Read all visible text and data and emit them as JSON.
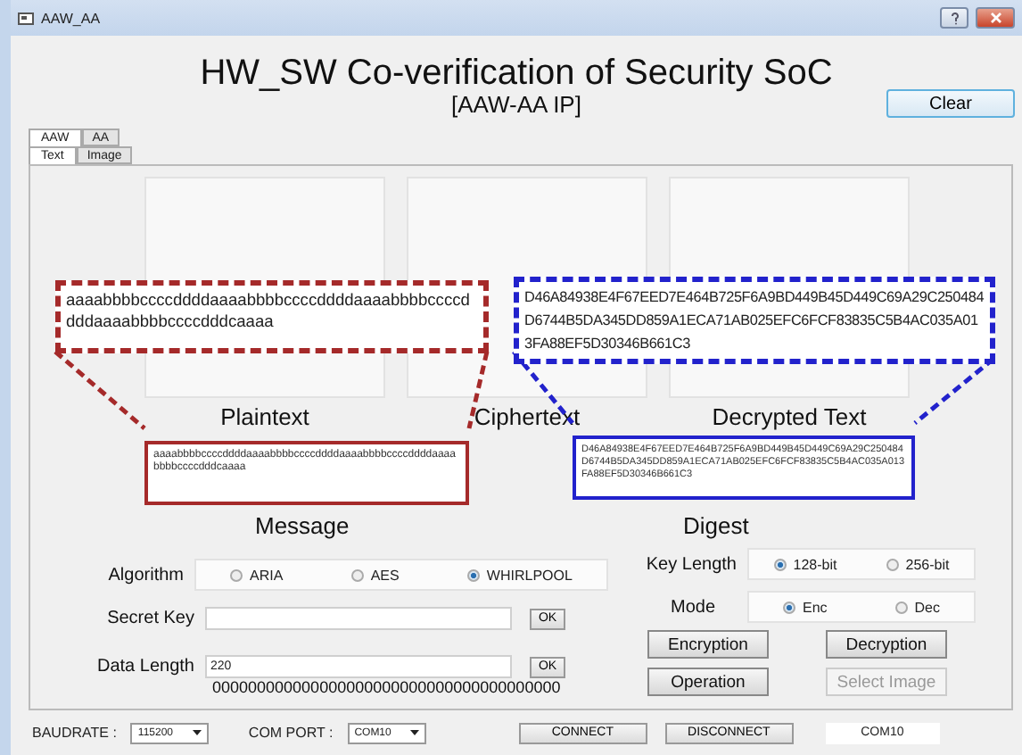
{
  "window": {
    "title": "AAW_AA"
  },
  "header": {
    "title": "HW_SW Co-verification of Security SoC",
    "subtitle": "[AAW-AA IP]",
    "clear_button": "Clear"
  },
  "tab_rows": [
    [
      {
        "label": "AAW",
        "selected": true
      },
      {
        "label": "AA",
        "selected": false
      }
    ],
    [
      {
        "label": "Text",
        "selected": true
      },
      {
        "label": "Image",
        "selected": false
      }
    ]
  ],
  "panes": [
    {
      "label": "Plaintext"
    },
    {
      "label": "Ciphertext"
    },
    {
      "label": "Decrypted Text"
    }
  ],
  "message": {
    "heading": "Message",
    "text": "aaaabbbbccccddddaaaabbbbccccddddaaaabbbbccccddddaaaabbbbccccdddcaaaa",
    "zoomed_text": "aaaabbbbccccddddaaaabbbbccccddddaaaabbbbccccddddaaaabbbbccccdddcaaaa"
  },
  "digest": {
    "heading": "Digest",
    "text": "D46A84938E4F67EED7E464B725F6A9BD449B45D449C69A29C250484D6744B5DA345DD859A1ECA71AB025EFC6FCF83835C5B4AC035A013FA88EF5D30346B661C3",
    "zoomed_text": "D46A84938E4F67EED7E464B725F6A9BD449B45D449C69A29C250484D6744B5DA345DD859A1ECA71AB025EFC6FCF83835C5B4AC035A013FA88EF5D30346B661C3"
  },
  "algorithm": {
    "label": "Algorithm",
    "options": [
      {
        "label": "ARIA",
        "selected": false
      },
      {
        "label": "AES",
        "selected": false
      },
      {
        "label": "WHIRLPOOL",
        "selected": true
      }
    ]
  },
  "secret_key": {
    "label": "Secret Key",
    "button": "OK"
  },
  "data_length": {
    "label": "Data Length",
    "value": "220",
    "button": "OK",
    "data": "000000000000000000000000000000000000000"
  },
  "key_length": {
    "label": "Key Length",
    "options": [
      {
        "label": "128-bit",
        "selected": true
      },
      {
        "label": "256-bit",
        "selected": false
      }
    ]
  },
  "mode": {
    "label": "Mode",
    "options": [
      {
        "label": "Enc",
        "selected": true
      },
      {
        "label": "Dec",
        "selected": false
      }
    ]
  },
  "actions": [
    {
      "label": "Encryption",
      "disabled": false
    },
    {
      "label": "Decryption",
      "disabled": false
    },
    {
      "label": "Operation",
      "disabled": false
    },
    {
      "label": "Select Image",
      "disabled": true
    }
  ],
  "status_bar": {
    "baudrate_label": "BAUDRATE :",
    "baudrate": "115200",
    "com_port_label": "COM PORT :",
    "com_port": "COM10",
    "connect": "CONNECT",
    "disconnect": "DISCONNECT",
    "port_display": "COM10"
  }
}
